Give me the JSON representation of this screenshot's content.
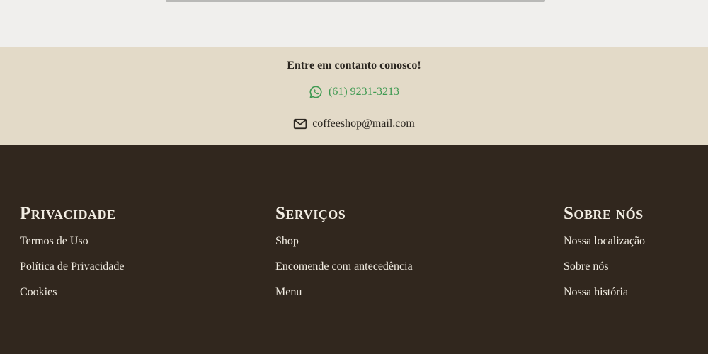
{
  "contact": {
    "title": "Entre em contanto conosco!",
    "phone": {
      "icon": "whatsapp-icon",
      "text": "(61) 9231-3213",
      "color": "#3f9a52"
    },
    "email": {
      "icon": "mail-icon",
      "text": "coffeeshop@mail.com"
    }
  },
  "footer": {
    "columns": [
      {
        "title": "Privacidade",
        "items": [
          "Termos de Uso",
          "Política de Privacidade",
          "Cookies"
        ]
      },
      {
        "title": "Serviços",
        "items": [
          "Shop",
          "Encomende com antecedência",
          "Menu"
        ]
      },
      {
        "title": "Sobre nós",
        "items": [
          "Nossa localização",
          "Sobre nós",
          "Nossa história"
        ]
      }
    ]
  },
  "colors": {
    "page_background": "#f0efed",
    "contact_background": "#e3dac8",
    "footer_background": "#31271e",
    "footer_text": "#f2ede3"
  }
}
